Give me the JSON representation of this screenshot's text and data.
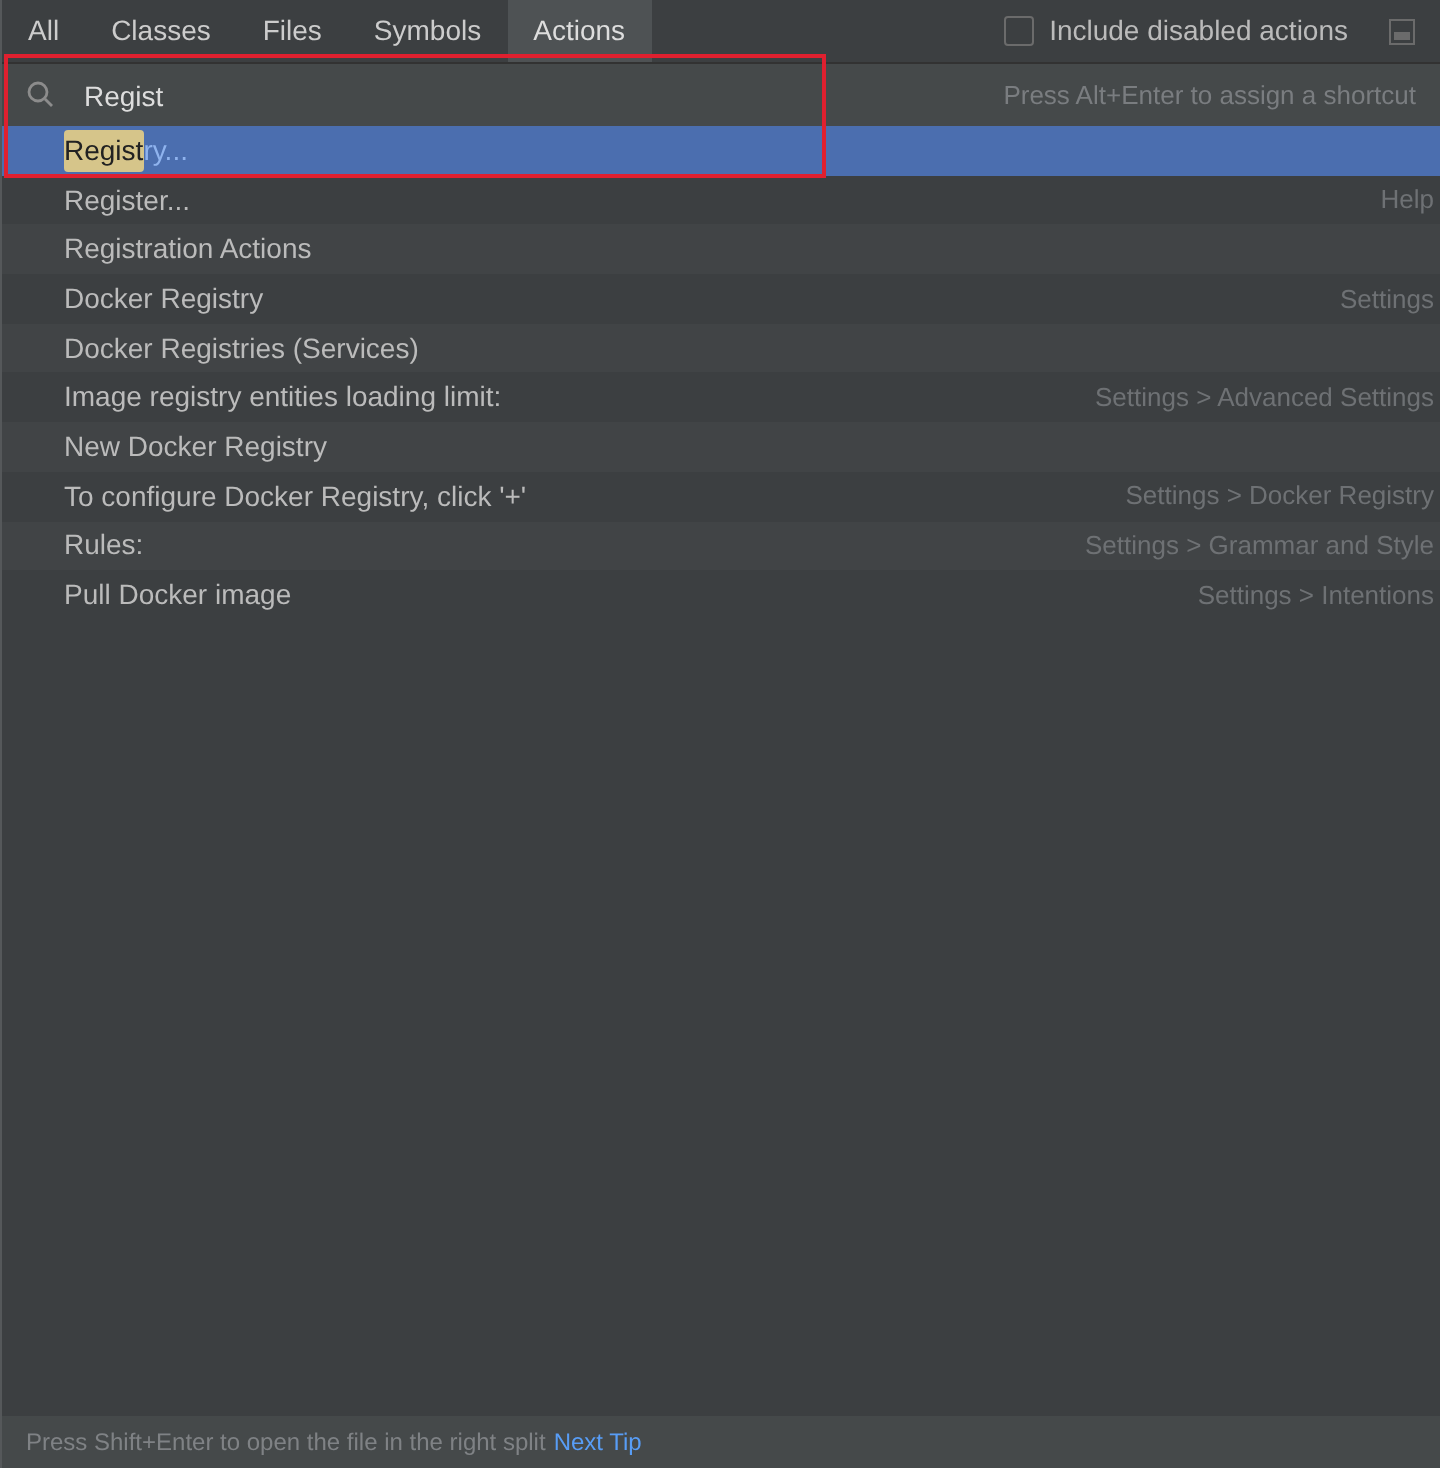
{
  "tabs": [
    {
      "label": "All",
      "selected": false
    },
    {
      "label": "Classes",
      "selected": false
    },
    {
      "label": "Files",
      "selected": false
    },
    {
      "label": "Symbols",
      "selected": false
    },
    {
      "label": "Actions",
      "selected": true
    }
  ],
  "include_disabled": {
    "label": "Include disabled actions",
    "checked": false
  },
  "search": {
    "value": "Regist",
    "hint": "Press Alt+Enter to assign a shortcut"
  },
  "results": [
    {
      "match": "Regist",
      "rest": "ry...",
      "selected": true
    },
    {
      "rest": "Register...",
      "location": "Help",
      "selected": false
    },
    {
      "rest": "Registration Actions",
      "selected": false
    },
    {
      "rest": "Docker Registry",
      "location": "Settings",
      "selected": false
    },
    {
      "rest": "Docker Registries (Services)",
      "selected": false
    },
    {
      "rest": "Image registry entities loading limit:",
      "location": "Settings > Advanced Settings",
      "selected": false
    },
    {
      "rest": "New Docker Registry",
      "selected": false
    },
    {
      "rest": "To configure Docker Registry, click '+'",
      "location": "Settings > Docker Registry",
      "selected": false
    },
    {
      "rest": "Rules:",
      "location": "Settings > Grammar and Style",
      "selected": false
    },
    {
      "rest": "Pull Docker image",
      "location": "Settings > Intentions",
      "selected": false
    }
  ],
  "status_bar": {
    "tip": "Press Shift+Enter to open the file in the right split",
    "link": "Next Tip"
  }
}
